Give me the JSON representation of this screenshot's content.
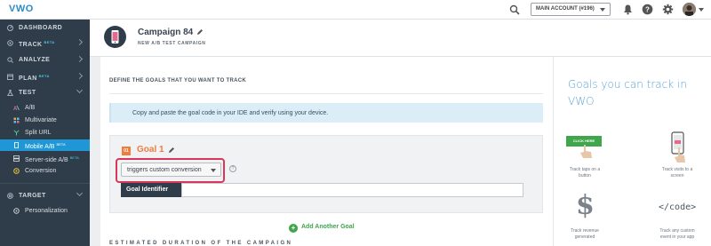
{
  "topbar": {
    "logo": "VWO",
    "account_label": "MAIN ACCOUNT (#196)"
  },
  "sidebar": {
    "items": [
      {
        "label": "DASHBOARD",
        "icon": "dashboard-icon",
        "beta": ""
      },
      {
        "label": "TRACK",
        "icon": "track-icon",
        "beta": "BETA"
      },
      {
        "label": "ANALYZE",
        "icon": "analyze-icon",
        "beta": ""
      },
      {
        "label": "PLAN",
        "icon": "plan-icon",
        "beta": "BETA"
      },
      {
        "label": "TEST",
        "icon": "test-icon",
        "beta": ""
      }
    ],
    "test_sub": [
      {
        "label": "A/B",
        "beta": ""
      },
      {
        "label": "Multivariate",
        "beta": ""
      },
      {
        "label": "Split URL",
        "beta": ""
      },
      {
        "label": "Mobile A/B",
        "beta": "BETA"
      },
      {
        "label": "Server-side A/B",
        "beta": "BETA"
      },
      {
        "label": "Conversion",
        "beta": ""
      }
    ],
    "target": {
      "label": "TARGET"
    },
    "target_sub": [
      {
        "label": "Personalization"
      }
    ]
  },
  "header": {
    "campaign_name": "Campaign 84",
    "subtitle": "NEW A/B TEST CAMPAIGN"
  },
  "main": {
    "section_title": "DEFINE THE GOALS THAT YOU WANT TO TRACK",
    "info_text": "Copy and paste the goal code in your IDE and verify using your device.",
    "goal": {
      "number": "01",
      "title": "Goal 1",
      "type_select": "triggers custom conversion",
      "identifier_label": "Goal Identifier",
      "identifier_value": ""
    },
    "add_goal": "Add Another Goal",
    "next_section": "ESTIMATED DURATION OF THE CAMPAIGN"
  },
  "right_panel": {
    "title": "Goals you can track in VWO",
    "features": [
      {
        "badge": "CLICK HERE",
        "line1": "Track taps on a",
        "line2": "button"
      },
      {
        "line1": "Track visits to a",
        "line2": "screen"
      },
      {
        "glyph": "$",
        "line1": "Track revenue",
        "line2": "generated"
      },
      {
        "glyph": "</code>",
        "line1": "Track any custom",
        "line2": "event in your app"
      }
    ]
  },
  "colors": {
    "sidebar_bg": "#2f3d4a",
    "active_blue": "#1f97d6",
    "goal_orange": "#f07c3e",
    "highlight_red": "#d9375a",
    "add_green": "#3fa64b",
    "panel_title_blue": "#5aa5d8"
  }
}
